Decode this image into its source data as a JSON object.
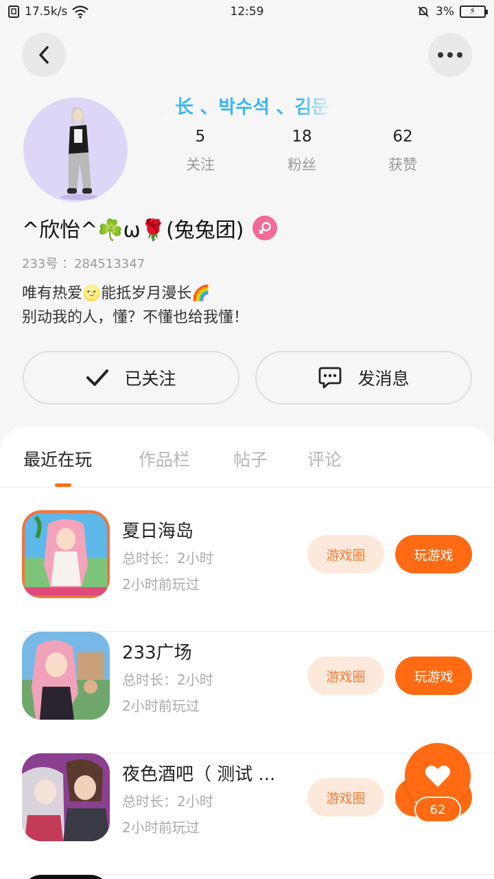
{
  "status_bar": {
    "network_speed": "17.5k/s",
    "time": "12:59",
    "battery": "3%"
  },
  "profile": {
    "marquee": "、长 、박수석 、김문철",
    "stats": [
      {
        "value": "5",
        "label": "关注"
      },
      {
        "value": "18",
        "label": "粉丝"
      },
      {
        "value": "62",
        "label": "获赞"
      }
    ],
    "nickname": "^欣怡^☘️ω🌹(兔兔团)",
    "uid": "233号 ：284513347",
    "bio_line1": "唯有热爱🌝能抵岁月漫长🌈",
    "bio_line2": "别动我的人，懂？不懂也给我懂！"
  },
  "actions": {
    "follow_label": "已关注",
    "message_label": "发消息"
  },
  "tabs": [
    {
      "label": "最近在玩"
    },
    {
      "label": "作品栏"
    },
    {
      "label": "帖子"
    },
    {
      "label": "评论"
    }
  ],
  "games": [
    {
      "title": "夏日海岛",
      "duration": "总时长：2小时",
      "last_played": "2小时前玩过",
      "circle_label": "游戏圈",
      "play_label": "玩游戏"
    },
    {
      "title": "233广场",
      "duration": "总时长：2小时",
      "last_played": "2小时前玩过",
      "circle_label": "游戏圈",
      "play_label": "玩游戏"
    },
    {
      "title": "夜色酒吧（ 测试 ...",
      "duration": "总时长：2小时",
      "last_played": "2小时前玩过",
      "circle_label": "游戏圈",
      "play_label": "玩游戏"
    }
  ],
  "like_fab": {
    "count": "62",
    "icon": "heart-icon"
  },
  "colors": {
    "accent": "#ff6a13",
    "accent_light": "#fde9dc",
    "link_blue": "#3db6ef",
    "gender_pink": "#f16a98"
  }
}
